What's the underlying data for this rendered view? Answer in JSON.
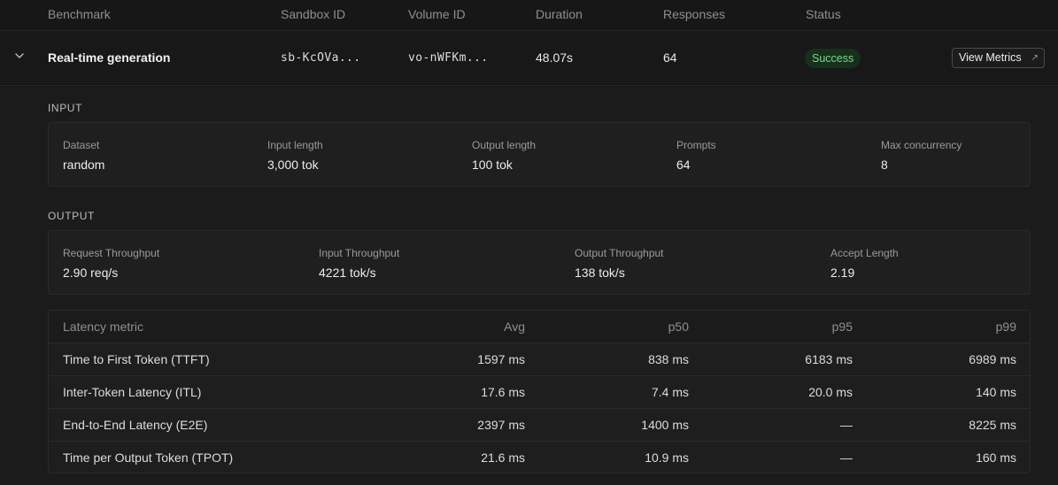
{
  "table": {
    "headers": [
      "Benchmark",
      "Sandbox ID",
      "Volume ID",
      "Duration",
      "Responses",
      "Status"
    ]
  },
  "run": {
    "benchmark": "Real-time generation",
    "sandbox_id": "sb-KcOVa...",
    "volume_id": "vo-nWFKm...",
    "duration": "48.07s",
    "responses": "64",
    "status": "Success",
    "status_color": "#7fd88a",
    "view_metrics_label": "View Metrics",
    "view_metrics_icon": "external-link-arrow",
    "expand_icon": "chevron-down"
  },
  "input": {
    "title": "INPUT",
    "fields": [
      {
        "label": "Dataset",
        "value": "random"
      },
      {
        "label": "Input length",
        "value": "3,000 tok"
      },
      {
        "label": "Output length",
        "value": "100 tok"
      },
      {
        "label": "Prompts",
        "value": "64"
      },
      {
        "label": "Max concurrency",
        "value": "8"
      }
    ]
  },
  "output": {
    "title": "OUTPUT",
    "fields": [
      {
        "label": "Request Throughput",
        "value": "2.90 req/s"
      },
      {
        "label": "Input Throughput",
        "value": "4221 tok/s"
      },
      {
        "label": "Output Throughput",
        "value": "138 tok/s"
      },
      {
        "label": "Accept Length",
        "value": "2.19"
      }
    ]
  },
  "latency": {
    "headers": [
      "Latency metric",
      "Avg",
      "p50",
      "p95",
      "p99"
    ],
    "rows": [
      [
        "Time to First Token (TTFT)",
        "1597 ms",
        "838 ms",
        "6183 ms",
        "6989 ms"
      ],
      [
        "Inter-Token Latency (ITL)",
        "17.6 ms",
        "7.4 ms",
        "20.0 ms",
        "140 ms"
      ],
      [
        "End-to-End Latency (E2E)",
        "2397 ms",
        "1400 ms",
        "—",
        "8225 ms"
      ],
      [
        "Time per Output Token (TPOT)",
        "21.6 ms",
        "10.9 ms",
        "—",
        "160 ms"
      ]
    ]
  }
}
